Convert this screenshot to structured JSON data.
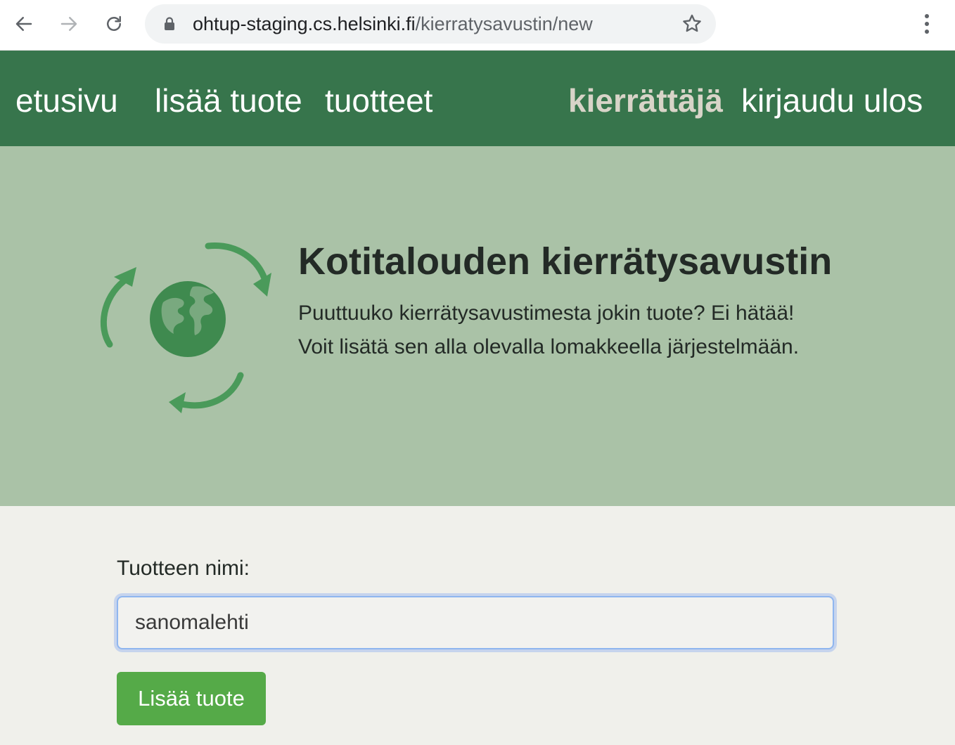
{
  "browser": {
    "url_host": "ohtup-staging.cs.helsinki.fi",
    "url_path": "/kierratysavustin/new",
    "icons": {
      "back": "arrow-left-icon",
      "forward": "arrow-right-icon",
      "reload": "reload-icon",
      "lock": "lock-icon",
      "bookmark": "star-icon",
      "menu": "vertical-dots-icon"
    }
  },
  "navbar": {
    "home": "etusivu",
    "add_product": "lisää tuote",
    "products": "tuotteet",
    "user": "kierrättäjä",
    "logout": "kirjaudu ulos",
    "background": "#37754c"
  },
  "hero": {
    "title": "Kotitalouden kierrätysavustin",
    "line1": "Puuttuuko kierrätysavustimesta jokin tuote? Ei hätää!",
    "line2": "Voit lisätä sen alla olevalla lomakkeella järjestelmään.",
    "logo_icon": "recycle-globe-icon",
    "background": "#aac2a7"
  },
  "form": {
    "label": "Tuotteen nimi:",
    "value": "sanomalehti",
    "submit_label": "Lisää tuote",
    "button_color": "#55aa48"
  }
}
